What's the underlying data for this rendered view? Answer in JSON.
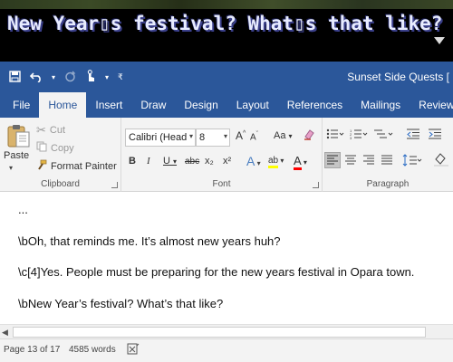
{
  "game": {
    "dialog_text": "New Year▯s festival? What▯s that like?",
    "advance_icon": "triangle-down-icon"
  },
  "titlebar": {
    "doc_title": "Sunset Side Quests [",
    "save_icon": "save-icon",
    "undo_icon": "undo-icon",
    "redo_icon": "redo-icon",
    "touch_icon": "touch-mode-icon",
    "customize_icon": "customize-qat-icon"
  },
  "tabs": [
    "File",
    "Home",
    "Insert",
    "Draw",
    "Design",
    "Layout",
    "References",
    "Mailings",
    "Review"
  ],
  "active_tab": "Home",
  "clipboard": {
    "paste_label": "Paste",
    "cut_label": "Cut",
    "copy_label": "Copy",
    "format_painter_label": "Format Painter",
    "group_label": "Clipboard"
  },
  "font": {
    "font_name": "Calibri (Head",
    "font_size": "8",
    "grow_label": "A",
    "shrink_label": "A",
    "case_label": "Aa",
    "bold_label": "B",
    "italic_label": "I",
    "underline_label": "U",
    "strike_label": "abc",
    "subscript_label": "x₂",
    "superscript_label": "x²",
    "effects_label": "A",
    "highlight_label": "ab",
    "color_label": "A",
    "group_label": "Font",
    "highlight_color": "#ffff00",
    "font_color": "#ff0000"
  },
  "paragraph": {
    "group_label": "Paragraph"
  },
  "document": {
    "lines": [
      "...",
      "\\bOh, that reminds me. It’s almost new years huh?",
      "\\c[4]Yes. People must be preparing for the new years festival in Opara town.",
      "\\bNew Year’s festival? What’s that like?"
    ]
  },
  "status": {
    "page": "Page 13 of 17",
    "words": "4585 words"
  }
}
